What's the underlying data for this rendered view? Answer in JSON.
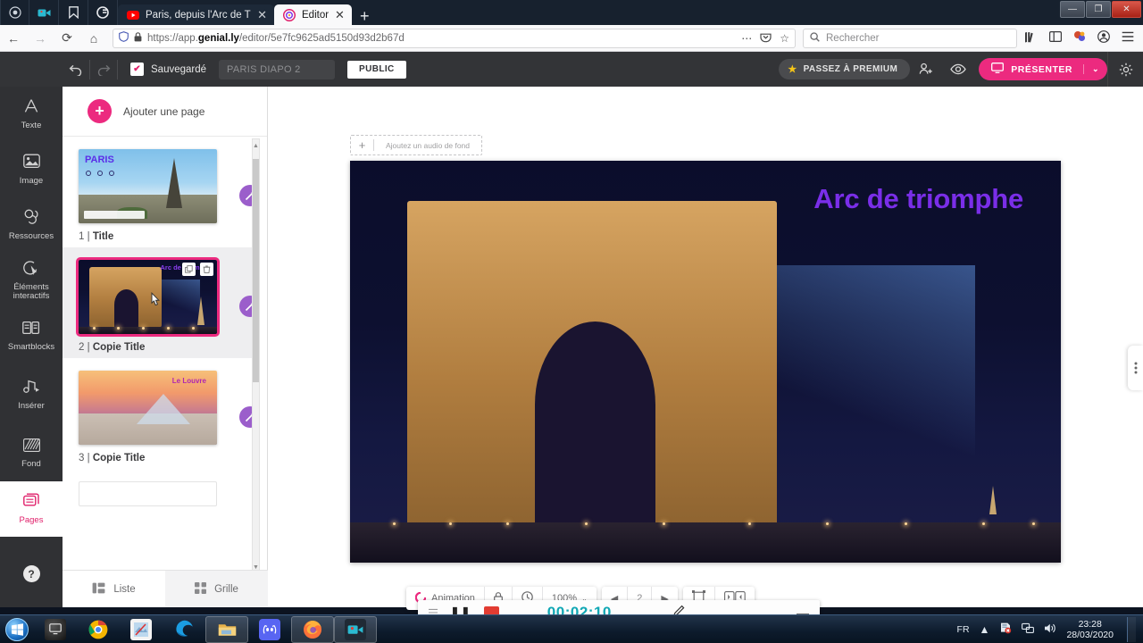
{
  "browser": {
    "quick_access": [
      "record-icon",
      "camera-icon",
      "bookmark-icon",
      "google-icon"
    ],
    "tabs": [
      {
        "title": "Paris, depuis l'Arc de Triomphe",
        "favicon": "youtube-icon",
        "active": false,
        "close": "✕"
      },
      {
        "title": "Editor",
        "favicon": "genially-icon",
        "active": true,
        "close": "✕"
      }
    ],
    "new_tab_label": "+",
    "window_controls": {
      "minimize": "—",
      "maximize": "❐",
      "close": "✕"
    },
    "nav": {
      "back": "←",
      "forward": "→",
      "reload": "⟳",
      "home": "⌂"
    },
    "address": {
      "protocol": "https://app.",
      "domain": "genial.ly",
      "path": "/editor/5e7fc9625ad5150d93d2b67d",
      "shield_icon": "shield-icon",
      "lock_icon": "lock-icon",
      "more_icon": "⋯",
      "pocket_icon": "pocket-icon",
      "bookmark_icon": "☆"
    },
    "search": {
      "placeholder": "Rechercher",
      "icon": "search-icon"
    },
    "toolbar_icons": [
      "library-icon",
      "sidebar-icon",
      "extension-icon",
      "account-icon",
      "menu-icon"
    ]
  },
  "app": {
    "logo": "genially-logo",
    "undo_icon": "undo-icon",
    "redo_icon": "redo-icon",
    "saved_label": "Sauvegardé",
    "saved_check": "✔",
    "doc_title": "PARIS DIAPO 2",
    "visibility_label": "PUBLIC",
    "premium_label": "PASSEZ À PREMIUM",
    "premium_star": "★",
    "share_icon": "add-user-icon",
    "preview_icon": "eye-icon",
    "present_label": "PRÉSENTER",
    "present_icon": "monitor-icon",
    "present_caret": "⌄",
    "settings_icon": "gear-icon"
  },
  "rail": {
    "items": [
      {
        "label": "Texte",
        "icon": "text-icon",
        "active": false
      },
      {
        "label": "Image",
        "icon": "image-icon",
        "active": false
      },
      {
        "label": "Ressources",
        "icon": "resources-icon",
        "active": false
      },
      {
        "label": "Éléments interactifs",
        "icon": "interactive-elements-icon",
        "active": false
      },
      {
        "label": "Smartblocks",
        "icon": "smartblocks-icon",
        "active": false
      },
      {
        "label": "Insérer",
        "icon": "insert-icon",
        "active": false
      },
      {
        "label": "Fond",
        "icon": "background-icon",
        "active": false
      },
      {
        "label": "Pages",
        "icon": "pages-icon",
        "active": true
      }
    ],
    "help_icon": "?"
  },
  "pages_panel": {
    "add_page_label": "Ajouter une page",
    "add_page_icon": "+",
    "pin_icon": "pin-icon",
    "wand_icon": "magic-wand-icon",
    "duplicate_icon": "duplicate-icon",
    "delete_icon": "trash-icon",
    "pages": [
      {
        "number": "1",
        "separator": "|",
        "name": "Title",
        "thumb_title": "PARIS",
        "selected": false,
        "art": "paris"
      },
      {
        "number": "2",
        "separator": "|",
        "name": "Copie Title",
        "thumb_title": "Arc de triomphe",
        "selected": true,
        "art": "arc"
      },
      {
        "number": "3",
        "separator": "|",
        "name": "Copie Title",
        "thumb_title": "Le Louvre",
        "selected": false,
        "art": "louvre"
      }
    ],
    "footer": [
      {
        "label": "Liste",
        "icon": "list-view-icon",
        "active": true
      },
      {
        "label": "Grille",
        "icon": "grid-view-icon",
        "active": false
      }
    ]
  },
  "canvas": {
    "audio_label": "Ajoutez un audio de fond",
    "audio_plus": "+",
    "slide_title": "Arc de triomphe",
    "slide_title_color": "#7a2ee8",
    "side_tab_icon": "more-vertical-icon"
  },
  "bottom_toolbar": {
    "animation_label": "Animation",
    "animation_icon": "animation-icon",
    "lock_icon": "lock-icon",
    "timer_icon": "clock-icon",
    "zoom_value": "100%",
    "zoom_caret": "⌄",
    "prev_icon": "◀",
    "page_number": "2",
    "next_icon": "▶",
    "fit_icon": "fit-screen-icon",
    "panel_toggle_icon": "panels-icon"
  },
  "recorder": {
    "drag_icon": "drag-handle-icon",
    "pause_icon": "❚❚",
    "stop_icon": "stop-icon",
    "time": "00:02:10",
    "pen_icon": "pen-icon",
    "minimize_icon": "—"
  },
  "taskbar": {
    "start_icon": "windows-start-icon",
    "items": [
      {
        "icon": "show-desktop-icon",
        "name": "desktop-peek",
        "running": false
      },
      {
        "icon": "chrome-icon",
        "name": "chrome",
        "running": false
      },
      {
        "icon": "paint-icon",
        "name": "paint",
        "running": false
      },
      {
        "icon": "edge-icon",
        "name": "edge",
        "running": false
      },
      {
        "icon": "explorer-icon",
        "name": "file-explorer",
        "running": true
      },
      {
        "icon": "discord-icon",
        "name": "discord",
        "running": false
      },
      {
        "icon": "firefox-icon",
        "name": "firefox",
        "running": true
      },
      {
        "icon": "recorder-icon",
        "name": "screen-recorder",
        "running": true
      }
    ],
    "tray": {
      "language": "FR",
      "show_hidden": "▲",
      "icons": [
        "security-icon",
        "network-icon",
        "volume-icon"
      ],
      "time": "23:28",
      "date": "28/03/2020"
    }
  }
}
